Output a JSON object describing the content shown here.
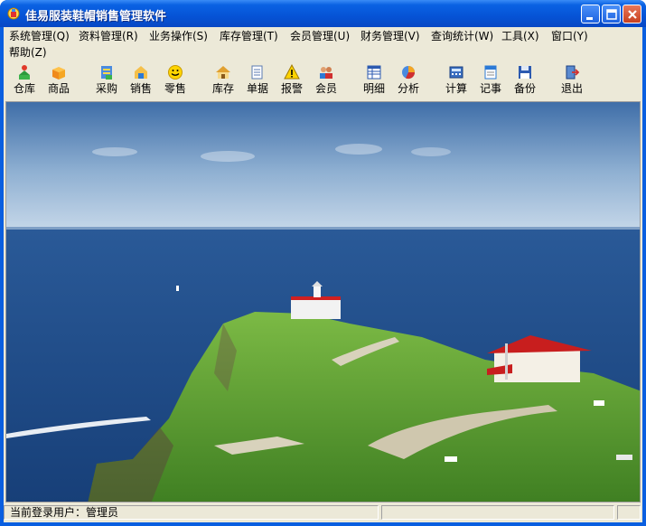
{
  "window": {
    "title": "佳易服装鞋帽销售管理软件",
    "title_color": "#ffffff",
    "accent": "#0a5fe0"
  },
  "titlebar_buttons": [
    {
      "name": "minimize-button",
      "icon": "minimize-icon"
    },
    {
      "name": "maximize-button",
      "icon": "maximize-icon"
    },
    {
      "name": "close-button",
      "icon": "close-icon"
    }
  ],
  "menu": [
    {
      "label": "系统管理(Q)"
    },
    {
      "label": "资料管理(R)"
    },
    {
      "label": "业务操作(S)"
    },
    {
      "label": "库存管理(T)"
    },
    {
      "label": "会员管理(U)"
    },
    {
      "label": "财务管理(V)"
    },
    {
      "label": "查询统计(W)"
    },
    {
      "label": "工具(X)"
    },
    {
      "label": "窗口(Y)"
    },
    {
      "label": "帮助(Z)"
    }
  ],
  "toolbar": [
    {
      "label": "仓库",
      "icon": "warehouse-icon"
    },
    {
      "label": "商品",
      "icon": "product-box-icon"
    },
    {
      "label": "采购",
      "icon": "purchase-icon"
    },
    {
      "label": "销售",
      "icon": "sales-icon"
    },
    {
      "label": "零售",
      "icon": "retail-smiley-icon"
    },
    {
      "label": "库存",
      "icon": "inventory-house-icon"
    },
    {
      "label": "单据",
      "icon": "document-icon"
    },
    {
      "label": "报警",
      "icon": "warning-icon"
    },
    {
      "label": "会员",
      "icon": "members-icon"
    },
    {
      "label": "明细",
      "icon": "detail-list-icon"
    },
    {
      "label": "分析",
      "icon": "analysis-icon"
    },
    {
      "label": "计算",
      "icon": "calculator-icon"
    },
    {
      "label": "记事",
      "icon": "notepad-icon"
    },
    {
      "label": "备份",
      "icon": "backup-disk-icon"
    },
    {
      "label": "退出",
      "icon": "exit-door-icon"
    }
  ],
  "background": {
    "description_icon": "landscape-lighthouse-image",
    "sky_color": "#b8cce0",
    "sea_color": "#1f4e8c",
    "land_color": "#5a9a34"
  },
  "status": {
    "user_label": "当前登录用户：管理员",
    "cell2": "",
    "cell3": ""
  }
}
